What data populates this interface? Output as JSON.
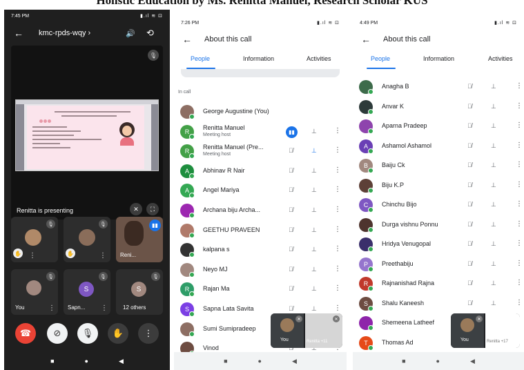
{
  "caption": "Holistic Education by Ms. Renitta Manuel, Research Scholar KUS",
  "screen1": {
    "status_time": "7:45 PM",
    "status_right": "▮.ıl ≋ ⊡",
    "meeting_code": "kmc-rpds-wqy ›",
    "presenting_label": "Renitta is presenting",
    "tiles": [
      {
        "name": ""
      },
      {
        "name": ""
      },
      {
        "name": "Reni..."
      },
      {
        "name": "You"
      },
      {
        "name": "Sapn...",
        "initial": "S"
      },
      {
        "name": "12 others",
        "initial": "S"
      }
    ],
    "icons": {
      "back": "back-arrow-icon",
      "volume": "volume-icon",
      "flip": "flip-camera-icon",
      "end": "end-call-icon",
      "camera_off": "camera-off-icon",
      "mic_off": "mic-off-icon",
      "hand": "raise-hand-icon",
      "more": "more-icon"
    }
  },
  "screen2": {
    "status_time": "7:26 PM",
    "title": "About this call",
    "tabs": [
      "People",
      "Information",
      "Activities"
    ],
    "section_label": "In call",
    "people": [
      {
        "name": "George Augustine (You)",
        "avatar_color": "#8d6e63",
        "initial": ""
      },
      {
        "name": "Renitta Manuel",
        "sub": "Meeting host",
        "avatar_color": "#43a047",
        "initial": "R",
        "speaking": true
      },
      {
        "name": "Renitta Manuel (Pre...",
        "sub": "Meeting host",
        "avatar_color": "#43a047",
        "initial": "R",
        "pin_blue": true
      },
      {
        "name": "Abhinav R Nair",
        "avatar_color": "#1e8e3e",
        "initial": "A"
      },
      {
        "name": "Angel Mariya",
        "avatar_color": "#34a853",
        "initial": "A"
      },
      {
        "name": "Archana biju Archa...",
        "avatar_color": "#9c27b0",
        "initial": ""
      },
      {
        "name": "GEETHU PRAVEEN",
        "avatar_color": "#b07a6a",
        "initial": ""
      },
      {
        "name": "kalpana s",
        "avatar_color": "#333333",
        "initial": ""
      },
      {
        "name": "Neyo MJ",
        "avatar_color": "#a1887f",
        "initial": ""
      },
      {
        "name": "Rajan Ma",
        "avatar_color": "#2e9d68",
        "initial": "R"
      },
      {
        "name": "Sapna Lata Savita",
        "avatar_color": "#7b3fe4",
        "initial": "S"
      },
      {
        "name": "Sumi Sumipradeep",
        "avatar_color": "#8d6e63",
        "initial": ""
      },
      {
        "name": "Vinod",
        "avatar_color": "#6d4c41",
        "initial": ""
      }
    ],
    "pip_you": "You",
    "pip_other": "Renitta +11"
  },
  "screen3": {
    "status_time": "4:49 PM",
    "title": "About this call",
    "tabs": [
      "People",
      "Information",
      "Activities"
    ],
    "people": [
      {
        "name": "Anagha B",
        "avatar_color": "#3d6b4a",
        "initial": ""
      },
      {
        "name": "Anvar K",
        "avatar_color": "#2d3a3a",
        "initial": ""
      },
      {
        "name": "Aparna Pradeep",
        "avatar_color": "#8e44ad",
        "initial": ""
      },
      {
        "name": "Ashamol Ashamol",
        "avatar_color": "#6a3fb5",
        "initial": "A"
      },
      {
        "name": "Baiju Ck",
        "avatar_color": "#a1887f",
        "initial": "B"
      },
      {
        "name": "Biju K.P",
        "avatar_color": "#5d4037",
        "initial": ""
      },
      {
        "name": "Chinchu Bijo",
        "avatar_color": "#7e57c2",
        "initial": "C"
      },
      {
        "name": "Durga vishnu Ponnu",
        "avatar_color": "#4e342e",
        "initial": ""
      },
      {
        "name": "Hridya Venugopal",
        "avatar_color": "#3a2f6b",
        "initial": ""
      },
      {
        "name": "Preethabiju",
        "avatar_color": "#9575cd",
        "initial": "P"
      },
      {
        "name": "Rajnanishad Rajna",
        "avatar_color": "#c0392b",
        "initial": "R"
      },
      {
        "name": "Shalu Kaneesh",
        "avatar_color": "#6d4c41",
        "initial": "S"
      },
      {
        "name": "Shemeena Latheef",
        "avatar_color": "#8e24aa",
        "initial": ""
      },
      {
        "name": "Thomas Ad",
        "avatar_color": "#e64a19",
        "initial": "T"
      }
    ],
    "pip_you": "You",
    "pip_other": "Renitta +17"
  },
  "colors": {
    "accent": "#1a73e8",
    "end_call": "#ea4335",
    "online_dot": "#34a853"
  }
}
